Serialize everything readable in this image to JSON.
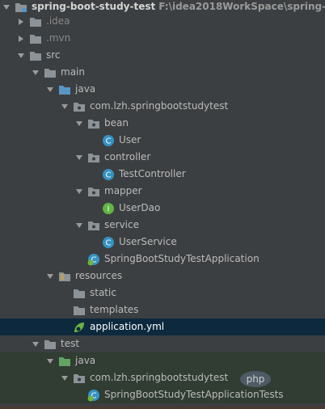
{
  "tree": {
    "root": {
      "label": "spring-boot-study-test",
      "path": "F:\\idea2018WorkSpace\\spring-boot-"
    },
    "nodes": [
      {
        "label": ".idea"
      },
      {
        "label": ".mvn"
      },
      {
        "label": "src"
      },
      {
        "label": "main"
      },
      {
        "label": "java"
      },
      {
        "label": "com.lzh.springbootstudytest"
      },
      {
        "label": "bean"
      },
      {
        "label": "User"
      },
      {
        "label": "controller"
      },
      {
        "label": "TestController"
      },
      {
        "label": "mapper"
      },
      {
        "label": "UserDao"
      },
      {
        "label": "service"
      },
      {
        "label": "UserService"
      },
      {
        "label": "SpringBootStudyTestApplication"
      },
      {
        "label": "resources"
      },
      {
        "label": "static"
      },
      {
        "label": "templates"
      },
      {
        "label": "application.yml"
      },
      {
        "label": "test"
      },
      {
        "label": "java"
      },
      {
        "label": "com.lzh.springbootstudytest"
      },
      {
        "label": "SpringBootStudyTestApplicationTests"
      }
    ]
  },
  "watermark": {
    "text": "php"
  },
  "colors": {
    "background": "#3c3f41",
    "selection": "#0d293e",
    "test_background": "#313c33",
    "folder": "#8c9398",
    "source_folder": "#5896c7",
    "test_folder": "#62a362",
    "class_icon": "#3592c4",
    "interface_icon": "#62b543"
  }
}
